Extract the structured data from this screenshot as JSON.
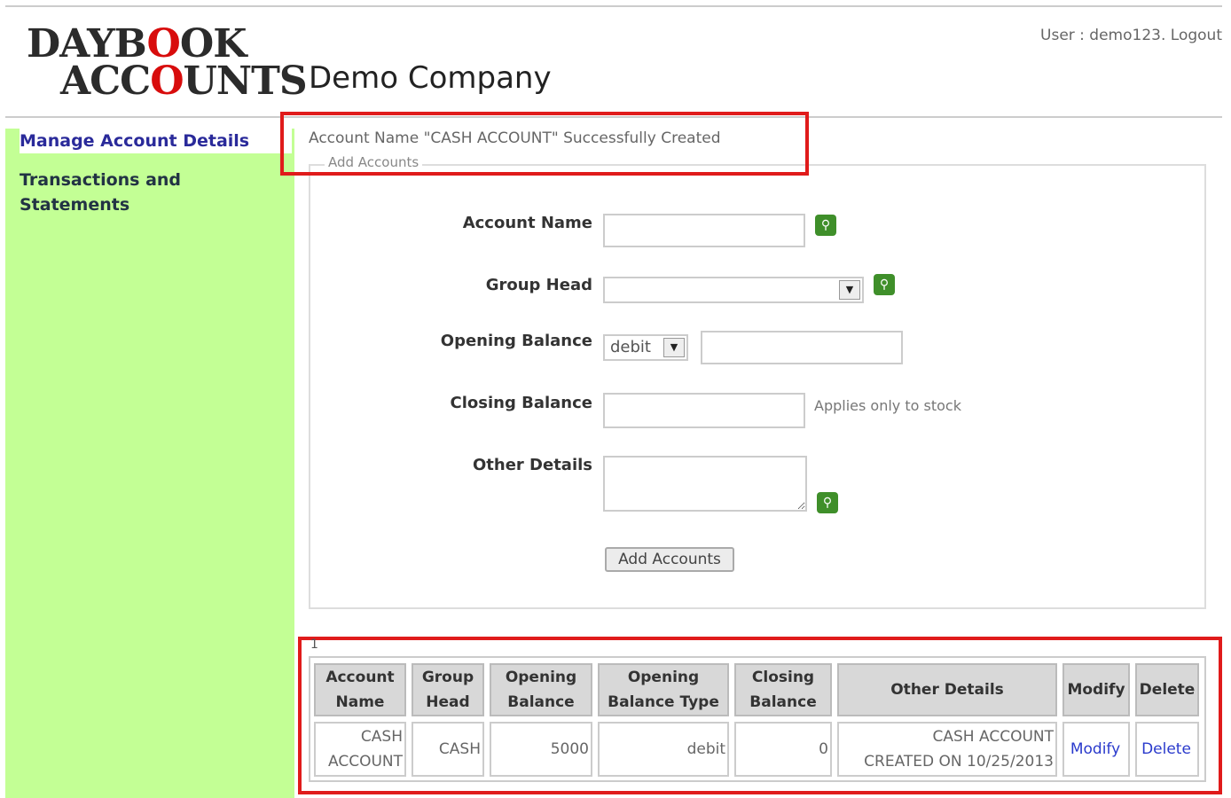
{
  "header": {
    "logo_line1": [
      "DAYB",
      "O",
      "OK"
    ],
    "logo_line2": [
      "ACC",
      "O",
      "UNTS"
    ],
    "company": "Demo Company",
    "user_label": "User : demo123.",
    "logout_label": "Logout"
  },
  "sidebar": {
    "items": [
      {
        "label": "Manage Account Details"
      },
      {
        "label_line1": "Transactions and",
        "label_line2": "Statements"
      }
    ]
  },
  "message": "Account Name \"CASH ACCOUNT\" Successfully Created",
  "form": {
    "legend": "Add Accounts",
    "account_name_label": "Account Name",
    "account_name_value": "",
    "group_head_label": "Group Head",
    "group_head_value": "",
    "opening_balance_label": "Opening Balance",
    "opening_balance_type": "debit",
    "opening_balance_value": "",
    "closing_balance_label": "Closing Balance",
    "closing_balance_value": "",
    "closing_note": "Applies only to stock",
    "other_details_label": "Other Details",
    "other_details_value": "",
    "submit_label": "Add Accounts"
  },
  "table": {
    "page": "1",
    "headers": [
      [
        "Account",
        "Name"
      ],
      [
        "Group",
        "Head"
      ],
      [
        "Opening",
        "Balance"
      ],
      [
        "Opening",
        "Balance Type"
      ],
      [
        "Closing",
        "Balance"
      ],
      [
        "Other Details"
      ],
      [
        "Modify"
      ],
      [
        "Delete"
      ]
    ],
    "rows": [
      {
        "account_name": [
          "CASH",
          "ACCOUNT"
        ],
        "group_head": "CASH",
        "opening_balance": "5000",
        "opening_balance_type": "debit",
        "closing_balance": "0",
        "other_details": [
          "CASH ACCOUNT",
          "CREATED ON 10/25/2013"
        ],
        "modify": "Modify",
        "delete": "Delete"
      }
    ]
  },
  "colors": {
    "sidebar_bg": "#c3ff95",
    "highlight_border": "#e01b1b",
    "logo_accent": "#d80c0c",
    "lookup_button": "#3f8f2a",
    "link": "#2a3acc"
  },
  "icons": {
    "lookup": "magnifier-icon",
    "dropdown": "chevron-down-icon"
  }
}
